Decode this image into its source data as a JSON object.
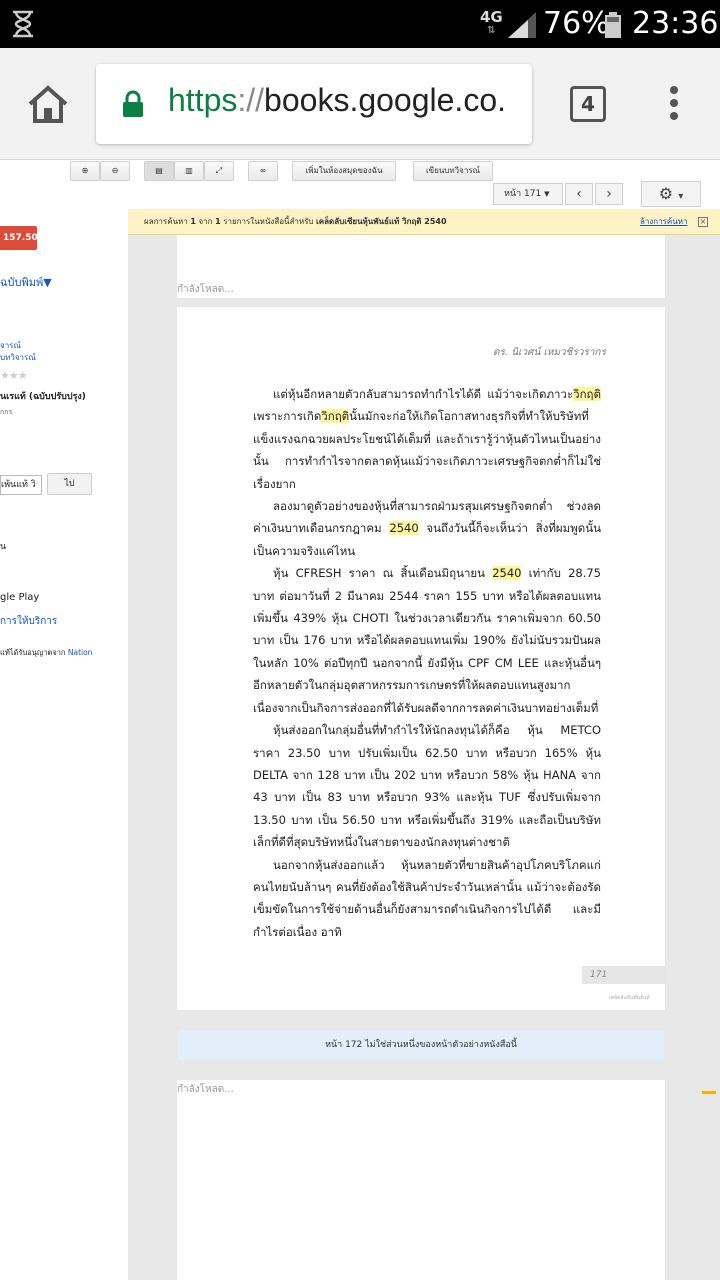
{
  "status_bar": {
    "network": "4G",
    "battery_percent": "76%",
    "time": "23:36"
  },
  "browser": {
    "url_scheme": "https",
    "url_sep": "://",
    "url_host": "books.google.co.",
    "tab_count": "4"
  },
  "toolbar": {
    "add_to_library": "เพิ่มในห้องสมุดของฉัน",
    "write_review": "เขียนบทวิจารณ์",
    "page_select": "หน้า 171",
    "page_caret": "▼",
    "prev": "‹",
    "next": "›",
    "settings_icon_glyph": "⚙",
    "settings_caret": "▾"
  },
  "sidebar": {
    "price": "157.50",
    "editions_link": "ฉบับพิมพ์▼",
    "stars": "★★★",
    "review_link_1": "จารณ์",
    "review_link_2": "บทวิจารณ์",
    "title": "ุนเรแท้ (ฉบับปรับปรุง)",
    "subtitle": "กกร",
    "search_value": "เพ้นแท้ วิ",
    "go_button": "ไป",
    "item_a": "น",
    "google_play": "gle Play",
    "terms_link": "การให้บริการ",
    "license_text": "แท้ได้รับอนุญาตจาก",
    "license_link": "Nation"
  },
  "search_banner": {
    "prefix": "ผลการค้นหา",
    "n1": "1",
    "mid1": "จาก",
    "n2": "1",
    "mid2": "รายการในหนังสือนี้สำหรับ",
    "query": "เคล็ดลับเซียนหุ้นพันธ์แท้ วิกฤติ 2540",
    "clear": "ล้างการค้นหา",
    "close": "×"
  },
  "pages": {
    "loading_top": "กำลังโหลด...",
    "running_head": "ดร. นิเวศน์ เหมวชิรวรากร",
    "paragraphs": [
      [
        "แต่หุ้นอีกหลายตัวกลับสามารถทำกำไรได้ดี แม้ว่าจะเกิดภาวะ",
        "วิกฤติ",
        " เพราะการเกิด",
        "วิกฤติ",
        "นั้นมักจะก่อให้เกิดโอกาสทางธุรกิจที่ทำให้บริษัทที่แข็งแรงฉกฉวยผลประโยชน์ได้เต็มที่ และถ้าเรารู้ว่าหุ้นตัวไหนเป็นอย่างนั้น การทำกำไรจากตลาดหุ้นแม้ว่าจะเกิดภาวะเศรษฐกิจตกต่ำก็ไม่ใช่เรื่องยาก"
      ],
      [
        "ลองมาดูตัวอย่างของหุ้นที่สามารถฝ่ามรสุมเศรษฐกิจตกต่ำ ช่วงลดค่าเงินบาทเดือนกรกฎาคม ",
        "2540",
        " จนถึงวันนี้ก็จะเห็นว่า สิ่งที่ผมพูดนั้นเป็นความจริงแค่ไหน"
      ],
      [
        "หุ้น CFRESH ราคา ณ สิ้นเดือนมิถุนายน ",
        "2540",
        " เท่ากับ 28.75 บาท ต่อมาวันที่ 2 มีนาคม 2544 ราคา 155 บาท หรือได้ผลตอบแทนเพิ่มขึ้น 439% หุ้น CHOTI ในช่วงเวลาเดียวกัน ราคาเพิ่มจาก 60.50 บาท เป็น 176 บาท หรือได้ผลตอบแทนเพิ่ม 190% ยังไม่นับรวมปันผลในหลัก 10% ต่อปีทุกปี นอกจากนี้ ยังมีหุ้น CPF CM LEE และหุ้นอื่นๆ อีกหลายตัวในกลุ่มอุตสาหกรรมการเกษตรที่ให้ผลตอบแทนสูงมาก เนื่องจากเป็นกิจการส่งออกที่ได้รับผลดีจากการลดค่าเงินบาทอย่างเต็มที่"
      ],
      [
        "หุ้นส่งออกในกลุ่มอื่นที่ทำกำไรให้นักลงทุนได้ก็คือ หุ้น METCO ราคา 23.50 บาท ปรับเพิ่มเป็น 62.50 บาท หรือบวก 165% หุ้น DELTA จาก 128 บาท เป็น 202 บาท หรือบวก 58% หุ้น HANA จาก 43 บาท เป็น 83 บาท หรือบวก 93% และหุ้น TUF ซึ่งปรับเพิ่มจาก 13.50 บาท เป็น 56.50 บาท หรือเพิ่มขึ้นถึง 319% และถือเป็นบริษัทเล็กที่ดีที่สุดบริษัทหนึ่งในสายตาของนักลงทุนต่างชาติ"
      ],
      [
        "นอกจากหุ้นส่งออกแล้ว หุ้นหลายตัวที่ขายสินค้าอุปโภคบริโภคแก่คนไทยนับล้านๆ คนที่ยังต้องใช้สินค้าประจำวันเหล่านั้น แม้ว่าจะต้องรัดเข็มขัดในการใช้จ่ายด้านอื่นก็ยังสามารถดำเนินกิจการไปได้ดี และมีกำไรต่อเนื่อง อาทิ"
      ]
    ],
    "page_number": "171",
    "page_footer": "เคล็ดลับหุ้นพันธ์แท้",
    "notice": "หน้า 172 ไม่ใช่ส่วนหนึ่งของหน้าตัวอย่างหนังสือนี้",
    "loading_bottom": "กำลังโหลด..."
  }
}
